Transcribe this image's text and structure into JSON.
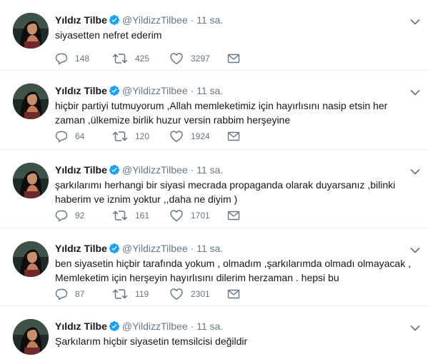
{
  "colors": {
    "text": "#14171a",
    "muted": "#657786",
    "verified": "#1da1f2",
    "divider": "#e6ecf0"
  },
  "icons": {
    "reply": "reply-icon",
    "retweet": "retweet-icon",
    "like": "heart-icon",
    "dm": "envelope-icon",
    "verified": "verified-badge-icon",
    "menu": "chevron-down-icon"
  },
  "tweets": [
    {
      "name": "Yıldız Tilbe",
      "handle": "@YildizzTilbee",
      "dot": "·",
      "time": "11 sa.",
      "text": "siyasetten nefret ederim",
      "replies": "148",
      "retweets": "425",
      "likes": "3297"
    },
    {
      "name": "Yıldız Tilbe",
      "handle": "@YildizzTilbee",
      "dot": "·",
      "time": "11 sa.",
      "text": "hiçbir partiyi tutmuyorum ,Allah memleketimiz için hayırlısını nasip etsin her zaman ,ülkemize birlik huzur versin rabbim herşeyine",
      "replies": "64",
      "retweets": "120",
      "likes": "1924"
    },
    {
      "name": "Yıldız Tilbe",
      "handle": "@YildizzTilbee",
      "dot": "·",
      "time": "11 sa.",
      "text": "şarkılarımı herhangi bir siyasi mecrada propaganda olarak duyarsanız ,bilinki haberim ve iznim yoktur ,,daha ne diyim )",
      "replies": "92",
      "retweets": "161",
      "likes": "1701"
    },
    {
      "name": "Yıldız Tilbe",
      "handle": "@YildizzTilbee",
      "dot": "·",
      "time": "11 sa.",
      "text": "ben siyasetin hiçbir tarafında yokum , olmadım ,şarkılarımda olmadı olmayacak , Memleketim için herşeyin hayırlısını dilerim herzaman . hepsi bu",
      "replies": "87",
      "retweets": "119",
      "likes": "2301"
    },
    {
      "name": "Yıldız Tilbe",
      "handle": "@YildizzTilbee",
      "dot": "·",
      "time": "11 sa.",
      "text": "Şarkılarım hiçbir siyasetin temsilcisi değildir"
    }
  ]
}
